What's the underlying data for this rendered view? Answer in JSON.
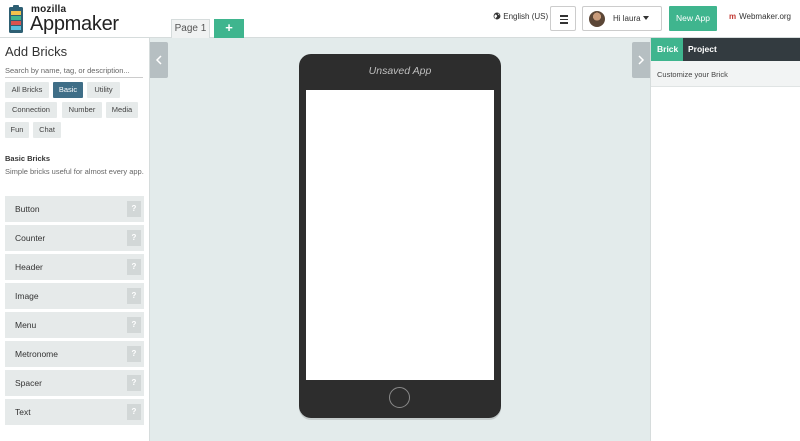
{
  "header": {
    "logo_small": "mozilla",
    "logo_big": "Appmaker",
    "page_tab": "Page 1",
    "add_page": "+",
    "language": "English (US)",
    "user_greeting": "Hi laura",
    "new_app": "New App",
    "webmaker": "Webmaker.org",
    "webmaker_mark": "m"
  },
  "sidebar": {
    "title": "Add Bricks",
    "search_placeholder": "Search by name, tag, or description...",
    "filters": [
      "All Bricks",
      "Basic",
      "Utility",
      "Connection",
      "Number",
      "Media",
      "Fun",
      "Chat"
    ],
    "active_filter": "Basic",
    "section_title": "Basic Bricks",
    "section_desc": "Simple bricks useful for almost every app.",
    "bricks": [
      "Button",
      "Counter",
      "Header",
      "Image",
      "Menu",
      "Metronome",
      "Spacer",
      "Text"
    ],
    "help_label": "?"
  },
  "canvas": {
    "app_title": "Unsaved App"
  },
  "right_panel": {
    "tabs": [
      "Brick",
      "Project"
    ],
    "active_tab": "Brick",
    "subheader": "Customize your Brick"
  },
  "colors": {
    "accent_green": "#3fb58e",
    "active_chip": "#3f6e87",
    "dark_tabbar": "#333b40",
    "canvas_bg": "#e3ebeb",
    "phone": "#2d2d2d"
  }
}
